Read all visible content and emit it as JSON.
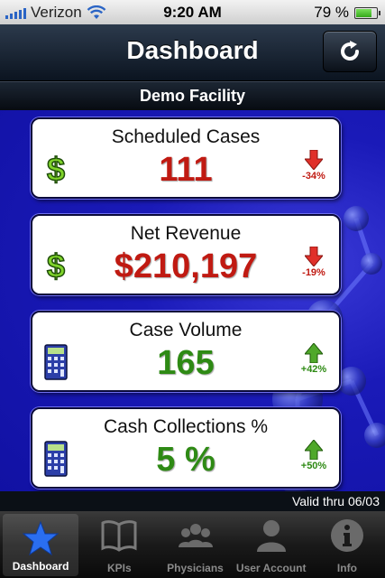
{
  "status_bar": {
    "carrier": "Verizon",
    "time": "9:20 AM",
    "battery_percent": "79 %",
    "battery_level": 0.79
  },
  "header": {
    "title": "Dashboard",
    "refresh_icon": "refresh-icon"
  },
  "facility": {
    "name": "Demo Facility"
  },
  "cards": [
    {
      "title": "Scheduled Cases",
      "value": "111",
      "value_color": "#c01a12",
      "icon": "dollar-icon",
      "trend": "down",
      "change": "-34%"
    },
    {
      "title": "Net Revenue",
      "value": "$210,197",
      "value_color": "#c01a12",
      "icon": "dollar-icon",
      "trend": "down",
      "change": "-19%"
    },
    {
      "title": "Case Volume",
      "value": "165",
      "value_color": "#2e8a14",
      "icon": "calculator-icon",
      "trend": "up",
      "change": "+42%"
    },
    {
      "title": "Cash Collections %",
      "value": "5 %",
      "value_color": "#2e8a14",
      "icon": "calculator-icon",
      "trend": "up",
      "change": "+50%"
    }
  ],
  "footer": {
    "valid_thru": "Valid thru 06/03"
  },
  "tabs": [
    {
      "label": "Dashboard",
      "icon": "star-icon",
      "active": true
    },
    {
      "label": "KPIs",
      "icon": "book-icon",
      "active": false
    },
    {
      "label": "Physicians",
      "icon": "group-icon",
      "active": false
    },
    {
      "label": "User Account",
      "icon": "user-icon",
      "active": false
    },
    {
      "label": "Info",
      "icon": "info-icon",
      "active": false
    }
  ],
  "colors": {
    "accent_blue": "#1a1ab8",
    "positive": "#2e8a14",
    "negative": "#c01a12",
    "active_tab_icon": "#2a6ef0"
  }
}
